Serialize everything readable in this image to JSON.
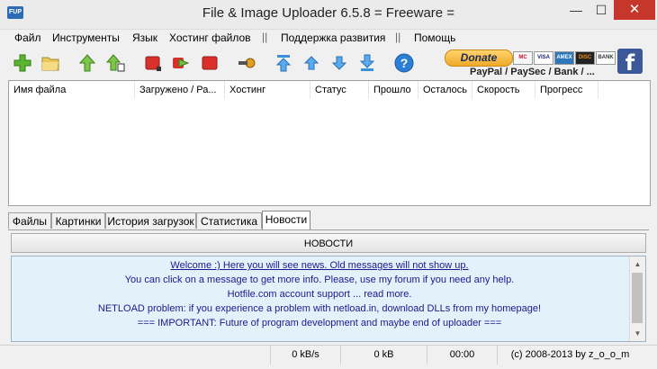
{
  "window": {
    "app_icon_text": "FUP",
    "title": "File & Image Uploader 6.5.8  = Freeware =",
    "minimize": "—",
    "maximize": "☐",
    "close": "✕"
  },
  "menu": {
    "items": [
      "Файл",
      "Инструменты",
      "Язык",
      "Хостинг файлов",
      "Поддержка развития",
      "Помощь"
    ],
    "separator": "||"
  },
  "toolbar": {
    "icons": [
      "add-icon",
      "open-folder-icon",
      "upload-icon",
      "upload-all-icon",
      "stop-icon",
      "transfer-icon",
      "stop-all-icon",
      "key-icon",
      "move-top-icon",
      "move-up-icon",
      "move-down-icon",
      "move-bottom-icon",
      "help-icon"
    ],
    "donate_label": "Donate",
    "cards": [
      "MC",
      "VISA",
      "AMEX",
      "DISC",
      "BANK"
    ],
    "payment_text": "PayPal / PaySec / Bank / ...",
    "facebook_label": "f"
  },
  "file_list": {
    "columns": [
      "Имя файла",
      "Загружено / Ра...",
      "Хостинг",
      "Статус",
      "Прошло",
      "Осталось",
      "Скорость",
      "Прогресс"
    ],
    "rows": []
  },
  "tabs": [
    "Файлы",
    "Картинки",
    "История загрузок",
    "Статистика",
    "Новости"
  ],
  "active_tab": "Новости",
  "news": {
    "header": "НОВОСТИ",
    "lines": [
      "Welcome :) Here you will see news. Old messages will not show up.",
      "You can click on a message to get more info. Please, use my forum if you need any help.",
      "Hotfile.com account support ... read more.",
      "NETLOAD problem: if you experience a problem with netload.in, download DLLs from my homepage!",
      "=== IMPORTANT: Future of program development and maybe end of uploader ==="
    ]
  },
  "status": {
    "speed": "0 kB/s",
    "size": "0 kB",
    "time": "00:00",
    "copyright": "(c) 2008-2013 by z_o_o_m"
  },
  "colors": {
    "close_button": "#c7362a",
    "news_background": "#e3f1fb",
    "news_text": "#1a1a8c",
    "facebook": "#3b5998"
  }
}
